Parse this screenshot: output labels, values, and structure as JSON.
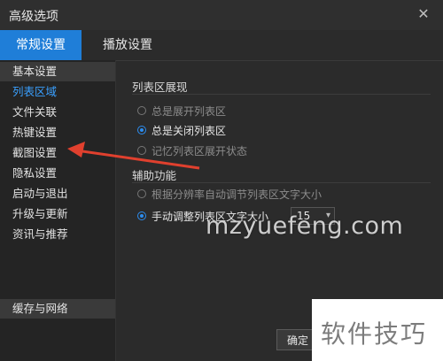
{
  "window": {
    "title": "高级选项"
  },
  "tabs": [
    {
      "label": "常规设置"
    },
    {
      "label": "播放设置"
    }
  ],
  "sidebar": {
    "items": [
      {
        "label": "基本设置"
      },
      {
        "label": "列表区域"
      },
      {
        "label": "文件关联"
      },
      {
        "label": "热键设置"
      },
      {
        "label": "截图设置"
      },
      {
        "label": "隐私设置"
      },
      {
        "label": "启动与退出"
      },
      {
        "label": "升级与更新"
      },
      {
        "label": "资讯与推荐"
      }
    ],
    "bottom_item": {
      "label": "缓存与网络"
    }
  },
  "content": {
    "section1": {
      "title": "列表区展现",
      "options": [
        {
          "label": "总是展开列表区",
          "checked": false
        },
        {
          "label": "总是关闭列表区",
          "checked": true
        },
        {
          "label": "记忆列表区展开状态",
          "checked": false
        }
      ]
    },
    "section2": {
      "title": "辅助功能",
      "options": [
        {
          "label": "根据分辨率自动调节列表区文字大小",
          "checked": false
        },
        {
          "label": "手动调整列表区文字大小",
          "checked": true
        }
      ],
      "font_size_value": "15"
    }
  },
  "buttons": {
    "ok": "确定"
  },
  "watermark": {
    "text": "mzyuefeng.com"
  },
  "badge": {
    "text": "软件技巧"
  },
  "colors": {
    "accent": "#1f7ed8",
    "active_text": "#3aa0ff",
    "arrow": "#e0402e"
  }
}
